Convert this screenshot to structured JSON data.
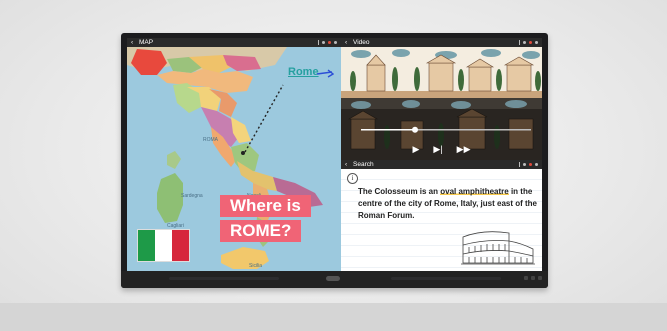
{
  "scene": {
    "colors": {
      "wall": "#ececec",
      "bezel": "#1c1c1e"
    }
  },
  "panes": {
    "map": {
      "title": "MAP",
      "labels": {
        "rome": "ROMA",
        "napoli": "Napoli",
        "sardegna": "Sardegna",
        "cagliari": "Cagliari",
        "sicilia": "Sicilia"
      },
      "annotation": "Rome",
      "callout": {
        "line1": "Where is",
        "line2": "ROME?"
      },
      "flag_colors": [
        "#1e9a48",
        "#ffffff",
        "#d6273c"
      ]
    },
    "video": {
      "title": "Video",
      "controls": [
        "play-icon",
        "skip-icon",
        "fast-forward-icon"
      ],
      "progress_fraction": 0.32
    },
    "search": {
      "title": "Search",
      "icon_letter": "i",
      "article": {
        "part1": "The Colosseum is an ",
        "highlight": "oval amphitheatre",
        "part2": " in the centre of the city of Rome, Italy, just east of the Roman Forum."
      }
    }
  }
}
